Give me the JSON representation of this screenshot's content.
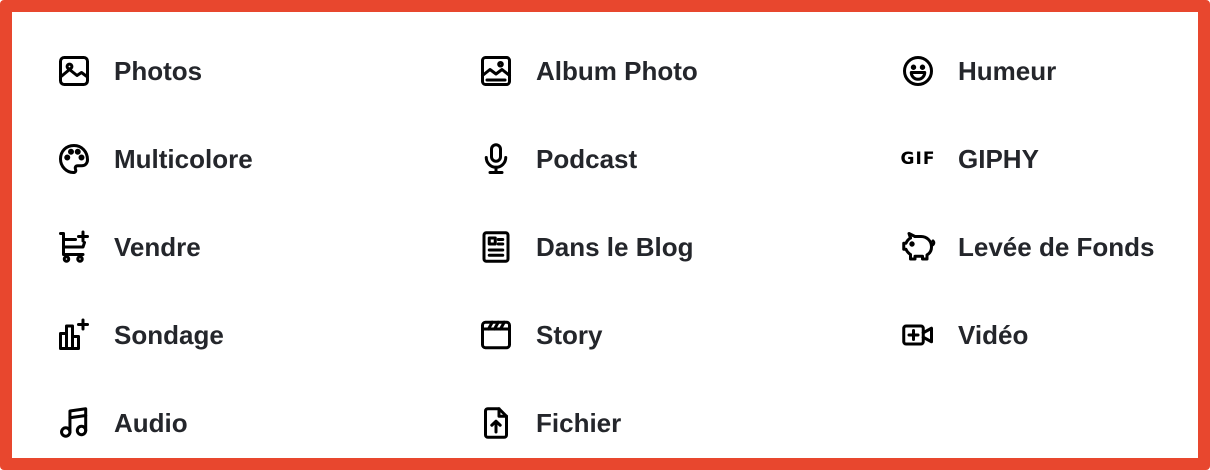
{
  "accent": "#e8472e",
  "items": [
    {
      "label": "Photos",
      "icon": "photo-icon"
    },
    {
      "label": "Album Photo",
      "icon": "photo-album-icon"
    },
    {
      "label": "Humeur",
      "icon": "smiley-icon"
    },
    {
      "label": "Multicolore",
      "icon": "palette-icon"
    },
    {
      "label": "Podcast",
      "icon": "microphone-icon"
    },
    {
      "label": "GIPHY",
      "icon": "gif-icon",
      "icon_text": "GIF"
    },
    {
      "label": "Vendre",
      "icon": "shopping-cart-add-icon"
    },
    {
      "label": "Dans le Blog",
      "icon": "article-icon"
    },
    {
      "label": "Levée de Fonds",
      "icon": "piggy-bank-icon"
    },
    {
      "label": "Sondage",
      "icon": "poll-add-icon"
    },
    {
      "label": "Story",
      "icon": "clapperboard-icon"
    },
    {
      "label": "Vidéo",
      "icon": "video-add-icon"
    },
    {
      "label": "Audio",
      "icon": "music-note-icon"
    },
    {
      "label": "Fichier",
      "icon": "file-upload-icon"
    }
  ]
}
